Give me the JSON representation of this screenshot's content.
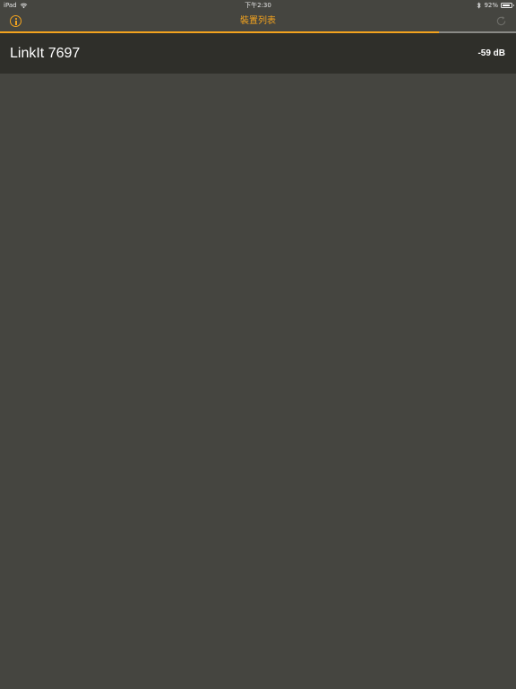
{
  "status_bar": {
    "device": "iPad",
    "time": "下午2:30",
    "battery_percent_label": "92%",
    "battery_level": 0.92,
    "icons": [
      "wifi-icon",
      "bluetooth-icon",
      "battery-icon"
    ]
  },
  "nav": {
    "title": "裝置列表",
    "left_icon": "info-icon",
    "right_icon": "refresh-icon",
    "scan_progress": 0.85
  },
  "devices": [
    {
      "name": "LinkIt 7697",
      "rssi": "-59 dB"
    }
  ],
  "colors": {
    "accent": "#f3a31e",
    "background": "#454540",
    "row_background": "#2f2f2a",
    "text": "#ffffff"
  }
}
